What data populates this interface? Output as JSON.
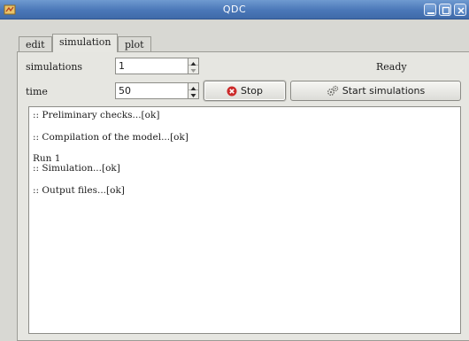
{
  "window": {
    "title": "QDC"
  },
  "tabs": [
    {
      "label": "edit",
      "active": false
    },
    {
      "label": "simulation",
      "active": true
    },
    {
      "label": "plot",
      "active": false
    }
  ],
  "simulation": {
    "simulations_label": "simulations",
    "simulations_value": "1",
    "time_label": "time",
    "time_value": "50",
    "status": "Ready",
    "stop_label": "Stop",
    "start_label": "Start simulations"
  },
  "log": {
    "lines": [
      ":: Preliminary checks...[ok]",
      ":: Compilation of the model...[ok]",
      "Run 1",
      ":: Simulation...[ok]",
      ":: Output files...[ok]"
    ]
  },
  "colors": {
    "titlebar": "#4a77b8",
    "stop_icon": "#cc2a2a"
  }
}
